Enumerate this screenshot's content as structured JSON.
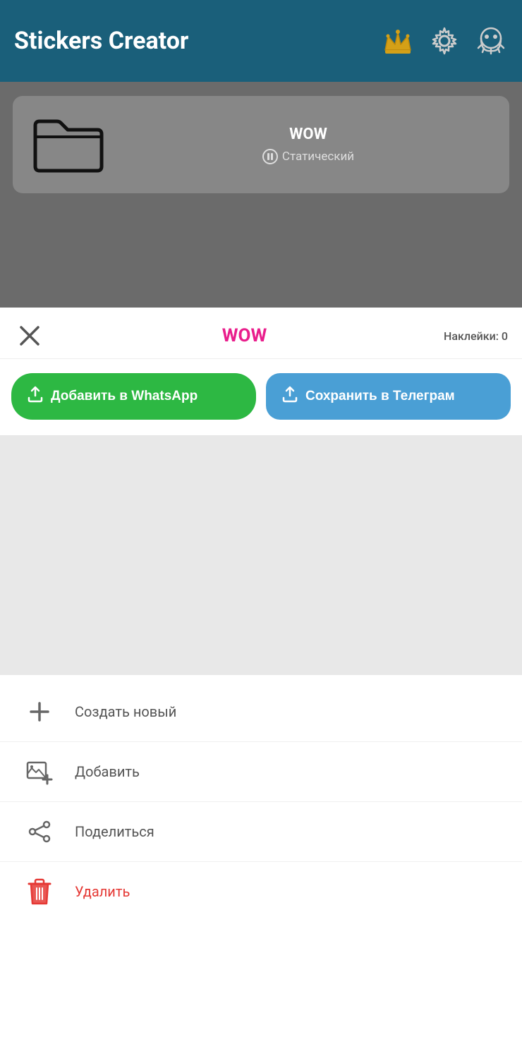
{
  "header": {
    "title": "Stickers Creator",
    "crown_icon": "crown",
    "settings_icon": "gear",
    "profile_icon": "ghost"
  },
  "pack_card": {
    "name": "WOW",
    "type_icon": "pause-circle",
    "type_label": "Статический"
  },
  "action_bar": {
    "pack_title": "WOW",
    "sticker_count_label": "Наклейки: 0"
  },
  "buttons": {
    "whatsapp_label": "Добавить в WhatsApp",
    "telegram_label": "Сохранить в Телеграм"
  },
  "menu": {
    "items": [
      {
        "icon": "plus",
        "label": "Создать новый",
        "color": "normal"
      },
      {
        "icon": "image-plus",
        "label": "Добавить",
        "color": "normal"
      },
      {
        "icon": "share",
        "label": "Поделиться",
        "color": "normal"
      },
      {
        "icon": "trash",
        "label": "Удалить",
        "color": "delete"
      }
    ]
  }
}
